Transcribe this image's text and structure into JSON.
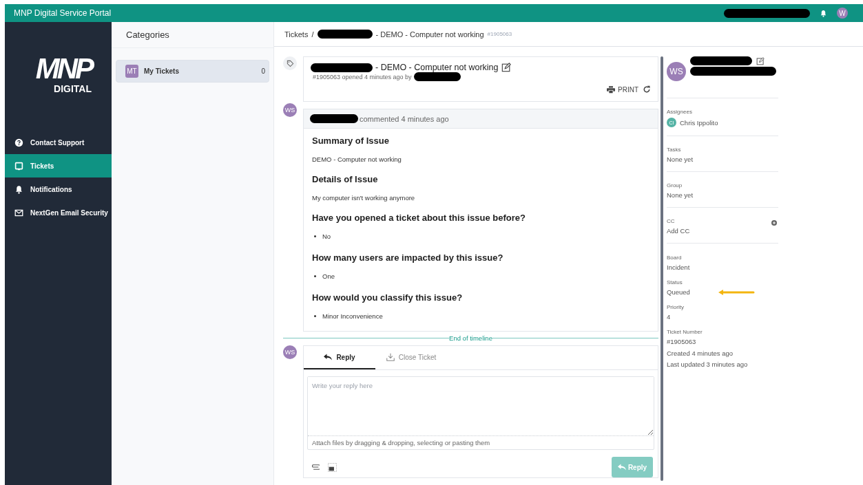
{
  "app_bar": {
    "title": "MNP Digital Service Portal",
    "avatar": "W"
  },
  "sidebar": {
    "logo": "MNP",
    "logo_sub": "DIGITAL",
    "items": [
      {
        "label": "Contact Support",
        "selected": false
      },
      {
        "label": "Tickets",
        "selected": true
      },
      {
        "label": "Notifications",
        "selected": false
      },
      {
        "label": "NextGen Email Security",
        "selected": false
      }
    ]
  },
  "categories": {
    "title": "Categories",
    "items": [
      {
        "badge": "MT",
        "label": "My Tickets",
        "count": "0",
        "selected": true
      }
    ]
  },
  "breadcrumb": {
    "root": "Tickets",
    "separator": "/",
    "title": "- DEMO - Computer not working",
    "number": "#1905063"
  },
  "ticket": {
    "title": "- DEMO - Computer not working",
    "meta": "#1905063 opened 4 minutes ago by",
    "print": "PRINT"
  },
  "comment": {
    "avatar": "WS",
    "header": "commented 4 minutes ago",
    "blocks": [
      {
        "kind": "heading",
        "text": "Summary of Issue"
      },
      {
        "kind": "text",
        "text": "DEMO - Computer not working"
      },
      {
        "kind": "heading",
        "text": "Details of Issue"
      },
      {
        "kind": "text",
        "text": "My computer isn't working anymore"
      },
      {
        "kind": "heading",
        "text": "Have you opened a ticket about this issue before?"
      },
      {
        "kind": "bullet",
        "text": "No"
      },
      {
        "kind": "heading",
        "text": "How many users are impacted by this issue?"
      },
      {
        "kind": "bullet",
        "text": "One"
      },
      {
        "kind": "heading",
        "text": "How would you classify this issue?"
      },
      {
        "kind": "bullet",
        "text": "Minor Inconvenience"
      }
    ]
  },
  "end_label": "End of timeline",
  "composer": {
    "avatar": "WS",
    "tabs": [
      {
        "label": "Reply",
        "selected": true
      },
      {
        "label": "Close Ticket",
        "selected": false
      }
    ],
    "placeholder": "Write your reply here",
    "attach_hint": "Attach files by dragging & dropping, selecting or pasting them",
    "submit": "Reply"
  },
  "details": {
    "avatar": "WS",
    "sections": [
      {
        "kind": "person",
        "label": "Assignees",
        "initials": "CI",
        "value": "Chris Ippolito"
      },
      {
        "kind": "text",
        "label": "Tasks",
        "value": "None yet"
      },
      {
        "kind": "text",
        "label": "Group",
        "value": "None yet"
      },
      {
        "kind": "add",
        "label": "CC",
        "value": "Add CC"
      }
    ],
    "fields": [
      {
        "label": "Board",
        "value": "Incident"
      },
      {
        "label": "Status",
        "value": "Queued"
      },
      {
        "label": "Priority",
        "value": "4"
      },
      {
        "label": "Ticket Number",
        "value": "#1905063"
      }
    ],
    "created": "Created 4 minutes ago",
    "updated": "Last updated 3 minutes ago"
  }
}
